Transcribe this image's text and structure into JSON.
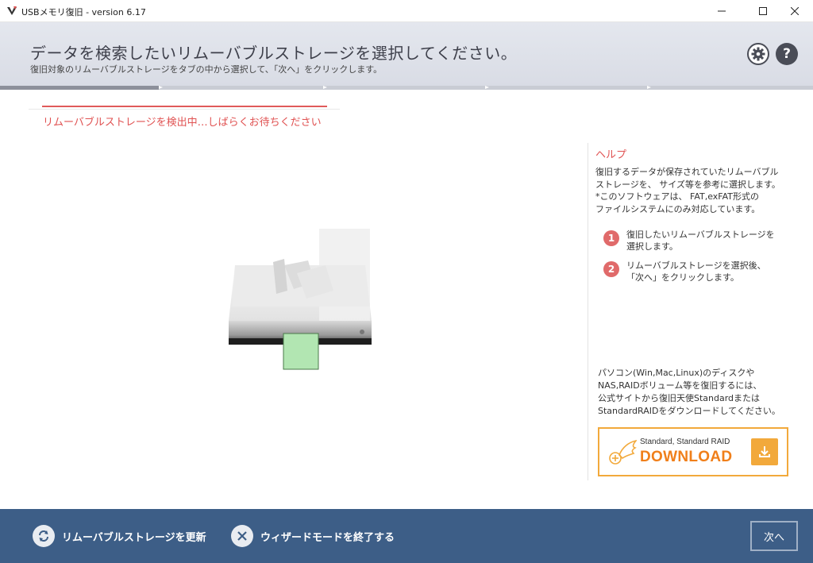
{
  "window": {
    "title": "USBメモリ復旧 - version 6.17"
  },
  "header": {
    "title": "データを検索したいリムーバブルストレージを選択してください。",
    "subtitle": "復旧対象のリムーバブルストレージをタブの中から選択して、「次へ」をクリックします。"
  },
  "detection": {
    "status": "リムーバブルストレージを検出中…しばらくお待ちください"
  },
  "help": {
    "title": "ヘルプ",
    "lines": [
      "復旧するデータが保存されていたリムーバブル",
      "ストレージを、 サイズ等を参考に選択します。",
      "*このソフトウェアは、 FAT,exFAT形式の",
      "ファイルシステムにのみ対応しています。"
    ],
    "steps": [
      {
        "num": "1",
        "line1": "復旧したいリムーバブルストレージを",
        "line2": "選択します。"
      },
      {
        "num": "2",
        "line1": "リムーバブルストレージを選択後、",
        "line2": "「次へ」をクリックします。"
      }
    ],
    "promo_lines": [
      "パソコン(Win,Mac,Linux)のディスクや",
      "NAS,RAIDボリューム等を復旧するには、",
      "公式サイトから復旧天使Standardまたは",
      "StandardRAIDをダウンロードしてください。"
    ],
    "download": {
      "subtitle": "Standard, Standard RAID",
      "label": "DOWNLOAD"
    }
  },
  "footer": {
    "refresh_label": "リムーバブルストレージを更新",
    "exit_label": "ウィザードモードを終了する",
    "next_label": "次へ"
  },
  "colors": {
    "accent_red": "#e05252",
    "footer_blue": "#3d5e87",
    "download_orange": "#f07f1a"
  }
}
